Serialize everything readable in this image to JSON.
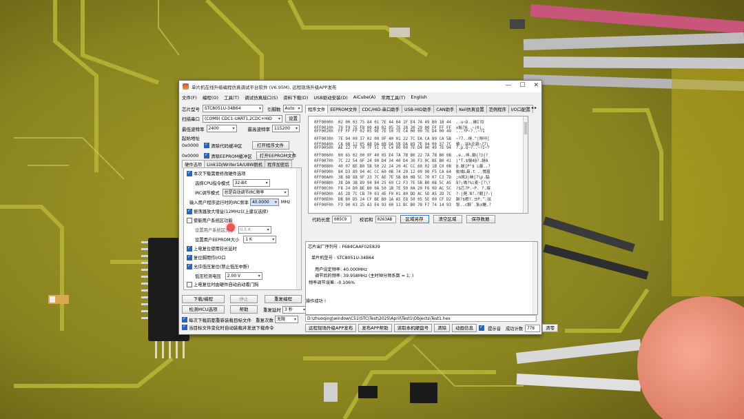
{
  "window": {
    "title": "单片机在线升级编程仿真调试平台软件 (V6.95M), 远程现场升级APP发布",
    "controls": [
      "—",
      "☐",
      "✕"
    ]
  },
  "menu": [
    "文件(F)",
    "编程(O)",
    "工具(T)",
    "调试仿真接口(S)",
    "资料下载(D)",
    "USB驱动安装(D)",
    "AiCube(A)",
    "常用工具(T)",
    "English"
  ],
  "left": {
    "chip_label": "芯片型号",
    "chip_value": "STC8051U-34B64",
    "pin_label": "引脚数",
    "pin_value": "Auto",
    "scan_button": "扫描串口",
    "port_value": "(COM9) CDC1-UART1,2CDC+HID",
    "settings_button": "设置",
    "min_baud_label": "最低波特率",
    "min_baud_value": "2400",
    "max_baud_label": "最高波特率",
    "max_baud_value": "115200",
    "start_addr_label": "起始地址",
    "addr1": "0x0000",
    "clear_code_label": "清除代码缓冲区",
    "open_program_button": "打开程序文件",
    "addr2": "0x0000",
    "clear_eeprom_label": "清除EEPROM缓冲区",
    "open_eeprom_button": "打开EEPROM文件",
    "tabs": [
      "硬件选项",
      "Link1D/Writer1A/U8W脱机",
      "程序加密后"
    ],
    "hw_options": {
      "opt1": "本次下载需要修改硬件选项",
      "cpu_mode_label": "选择CPU指令模式",
      "cpu_mode_value": "32-Bit",
      "irc_mode_label": "IRC调节模式",
      "irc_mode_value": "总是自动调节IRC频率",
      "freq_label": "输入用户程序运行时的IRC频率",
      "freq_value": "40.0000",
      "freq_unit": "MHz",
      "amp_label": "振荡器放大增益(12MHz以上建议选择)",
      "sys_area_label": "使能用户系统区功能",
      "sys_area_size_label": "设置用户系统区大小",
      "sys_area_size_value": "0.5 K",
      "eeprom_size_label": "设置用户EEPROM大小",
      "eeprom_size_value": "1 K",
      "wdt_label": "上电复位使用较长延时",
      "reset_pin_label": "复位脚用作I/O口",
      "lvr_label": "允许低压复位(禁止低压中断)",
      "lvd_label": "低压检测电压",
      "lvd_value": "2.00 V",
      "hw_wdt_label": "上电复位时由硬件自动启动看门狗"
    },
    "download_button": "下载/编程",
    "stop_button": "停止",
    "reprogram_button": "重复编程",
    "check_mcu_button": "检测MCU选项",
    "help_button": "帮助",
    "repeat_delay_label": "重复延时",
    "repeat_delay_value": "3 秒",
    "reload_label": "每次下载前都重新装载目标文件",
    "repeat_count_label": "重复次数",
    "repeat_count_value": "无限",
    "auto_send_label": "当目标文件变化时自动装载并发送下载命令"
  },
  "right": {
    "tabs": [
      "程序文件",
      "EEPROM文件",
      "CDC/HID-串口助手",
      "USB-HID助手",
      "CAN助手",
      "Keil仿真设置",
      "范例程序",
      "I/O口配置"
    ],
    "hex_lines": [
      "0FF0000h  02 00 03 75 84 01 7E 44 04 1F E4 7A 49 B0 1B 44  ..u~D..礇I?D",
      "0FF0010h  70 F9 7E F8 00 48 02 05 7E 28 30 29 00 FF FF FF  x駘?H..~(0).",
      "0FF0020h  FF FF FF 02 05 9E 7E 50 7E C4 00 00 7E D4 00 49  ...?P~?..~?I",
      "0FF0030h  7E 94 00 37 02 00 9F 40 01 22 7C EA CA 89 CA 5B  ~?7..燖.\"|陫呯[",
      "0FF0040h  CA 6B 12 05 AB DA 6B DA 5B DA 89 7E 94 00 37 7C  蔾..谄k赱趬~?7|",
      "0FF0050h  AE 22 7F 70 7F 51 7E C4 00 00 7E D4 00 49 7E 94  ?.p.Q~?..~?I~?",
      "0FF0060h  00 65 02 00 9F 40 05 E4 7A 7B B0 22 7A 7B B0 0B  .e..燖.鋤{?z{?",
      "0FF0070h  7C 22 54 0F 24 90 D4 34 40 D4 30 F3 0C BE B0 41  |\"T.$愒4@?.緹A",
      "0FF0080h  40 07 BE B0 5B 50 22 24 20 4C CC 68 02 1B C0 0B  @.緹[P\"$ L蘦..?",
      "0FF0090h  84 D3 89 94 4C CC 60 0B 74 20 12 09 90 F5 CA 64  勛墧L蘞.t ..愰蔰",
      "0FF00A0h  3B 6D 88 9F 33 7C AE 7E 5B B0 0B 5C 70 07 C3 7D  ;m垷3|畘[?\\p.脇",
      "0FF00B0h  38 DA 3B 89 94 84 25 69 C2 F3 7E 5B B0 0B 5C A5  8?;墧?%i麦~[?\\?",
      "0FF00C0h  F8 24 D0 BE B0 0A 50 1B 7E 50 0A 20 F6 0D AC 5C  ?$芯?P.~P. ?.琝",
      "0FF00D0h  A5 2D 7C CB 70 03 4E F0 01 80 DD AC 5D A5 2D 7C  ?-|藀.N?.?輥]?-|",
      "0FF00E0h  DB 80 D5 24 CF BE B0 1A A5 E8 50 05 5E 00 CF D2  踿?$暇?.ヨP.^.弦",
      "0FF00F0h  F3 90 03 15 A3 E4 93 60 11 BC B0 78 F7 74 14 93  髳..c鋼`.紥x鱰.?"
    ],
    "code_len_label": "代码长度",
    "code_len_value": "005C9",
    "checksum_label": "校验和",
    "checksum_value": "0263AB",
    "save_area_button": "区域另存",
    "clear_area_button": "清空区域",
    "save_data_button": "保存数据",
    "info": {
      "chip_serial": "芯片出厂序列号 : F684CAAF02E839",
      "model": "单片机型号 : STC8051U-34B64",
      "user_freq": "用户设定频率: 40.000MHz",
      "adjusted_freq": "调节后的频率: 39.958MHz (主时钟分频系数 = 1; )",
      "freq_error": "频率调节误差: -0.106%",
      "success": "操作成功 !"
    },
    "path": "D:\\zhuoqing\\window\\C51\\STC\\Test\\2025\\April\\Test1\\Objects\\Test1.hex",
    "bottom": {
      "publish_button": "远程现场升级APP发布",
      "release_help_button": "发布APP帮助",
      "read_disk_button": "读取本机硬盘号",
      "clear_button": "清除",
      "anim_button": "动画信息",
      "prompt_label": "提示音",
      "success_count_label": "成功计数",
      "success_count_value": "778",
      "clear_zero_button": "清零"
    }
  }
}
